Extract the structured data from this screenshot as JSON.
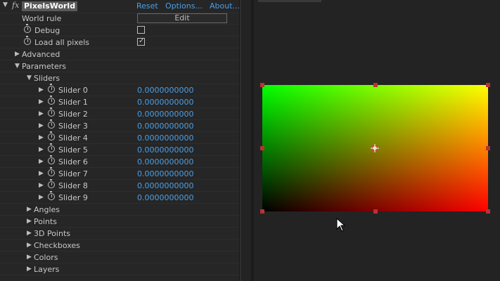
{
  "effect": {
    "collapse_arrow": "▼",
    "fx_label": "fx",
    "name": "PixelsWorld",
    "links": {
      "reset": "Reset",
      "options": "Options...",
      "about": "About..."
    }
  },
  "rows": {
    "world_rule": {
      "label": "World rule",
      "button": "Edit"
    },
    "debug": {
      "label": "Debug",
      "checked": false
    },
    "load_all_pixels": {
      "label": "Load all pixels",
      "checked": true,
      "check_glyph": "✓"
    },
    "advanced": {
      "label": "Advanced",
      "arrow": "▶"
    },
    "parameters": {
      "label": "Parameters",
      "arrow": "▼"
    },
    "sliders": {
      "label": "Sliders",
      "arrow": "▼"
    }
  },
  "sliders": [
    {
      "label": "Slider 0",
      "value": "0.0000000000"
    },
    {
      "label": "Slider 1",
      "value": "0.0000000000"
    },
    {
      "label": "Slider 2",
      "value": "0.0000000000"
    },
    {
      "label": "Slider 3",
      "value": "0.0000000000"
    },
    {
      "label": "Slider 4",
      "value": "0.0000000000"
    },
    {
      "label": "Slider 5",
      "value": "0.0000000000"
    },
    {
      "label": "Slider 6",
      "value": "0.0000000000"
    },
    {
      "label": "Slider 7",
      "value": "0.0000000000"
    },
    {
      "label": "Slider 8",
      "value": "0.0000000000"
    },
    {
      "label": "Slider 9",
      "value": "0.0000000000"
    }
  ],
  "slider_arrow": "▶",
  "groups": [
    {
      "label": "Angles",
      "arrow": "▶"
    },
    {
      "label": "Points",
      "arrow": "▶"
    },
    {
      "label": "3D Points",
      "arrow": "▶"
    },
    {
      "label": "Checkboxes",
      "arrow": "▶"
    },
    {
      "label": "Colors",
      "arrow": "▶"
    },
    {
      "label": "Layers",
      "arrow": "▶"
    }
  ],
  "viewer": {
    "gradient": {
      "top_left": "#00ff00",
      "top_right": "#ffff00",
      "bottom_left": "#000000",
      "bottom_right": "#ff0000"
    },
    "handle_color": "#b83232",
    "value_color": "#4a9fe8"
  }
}
